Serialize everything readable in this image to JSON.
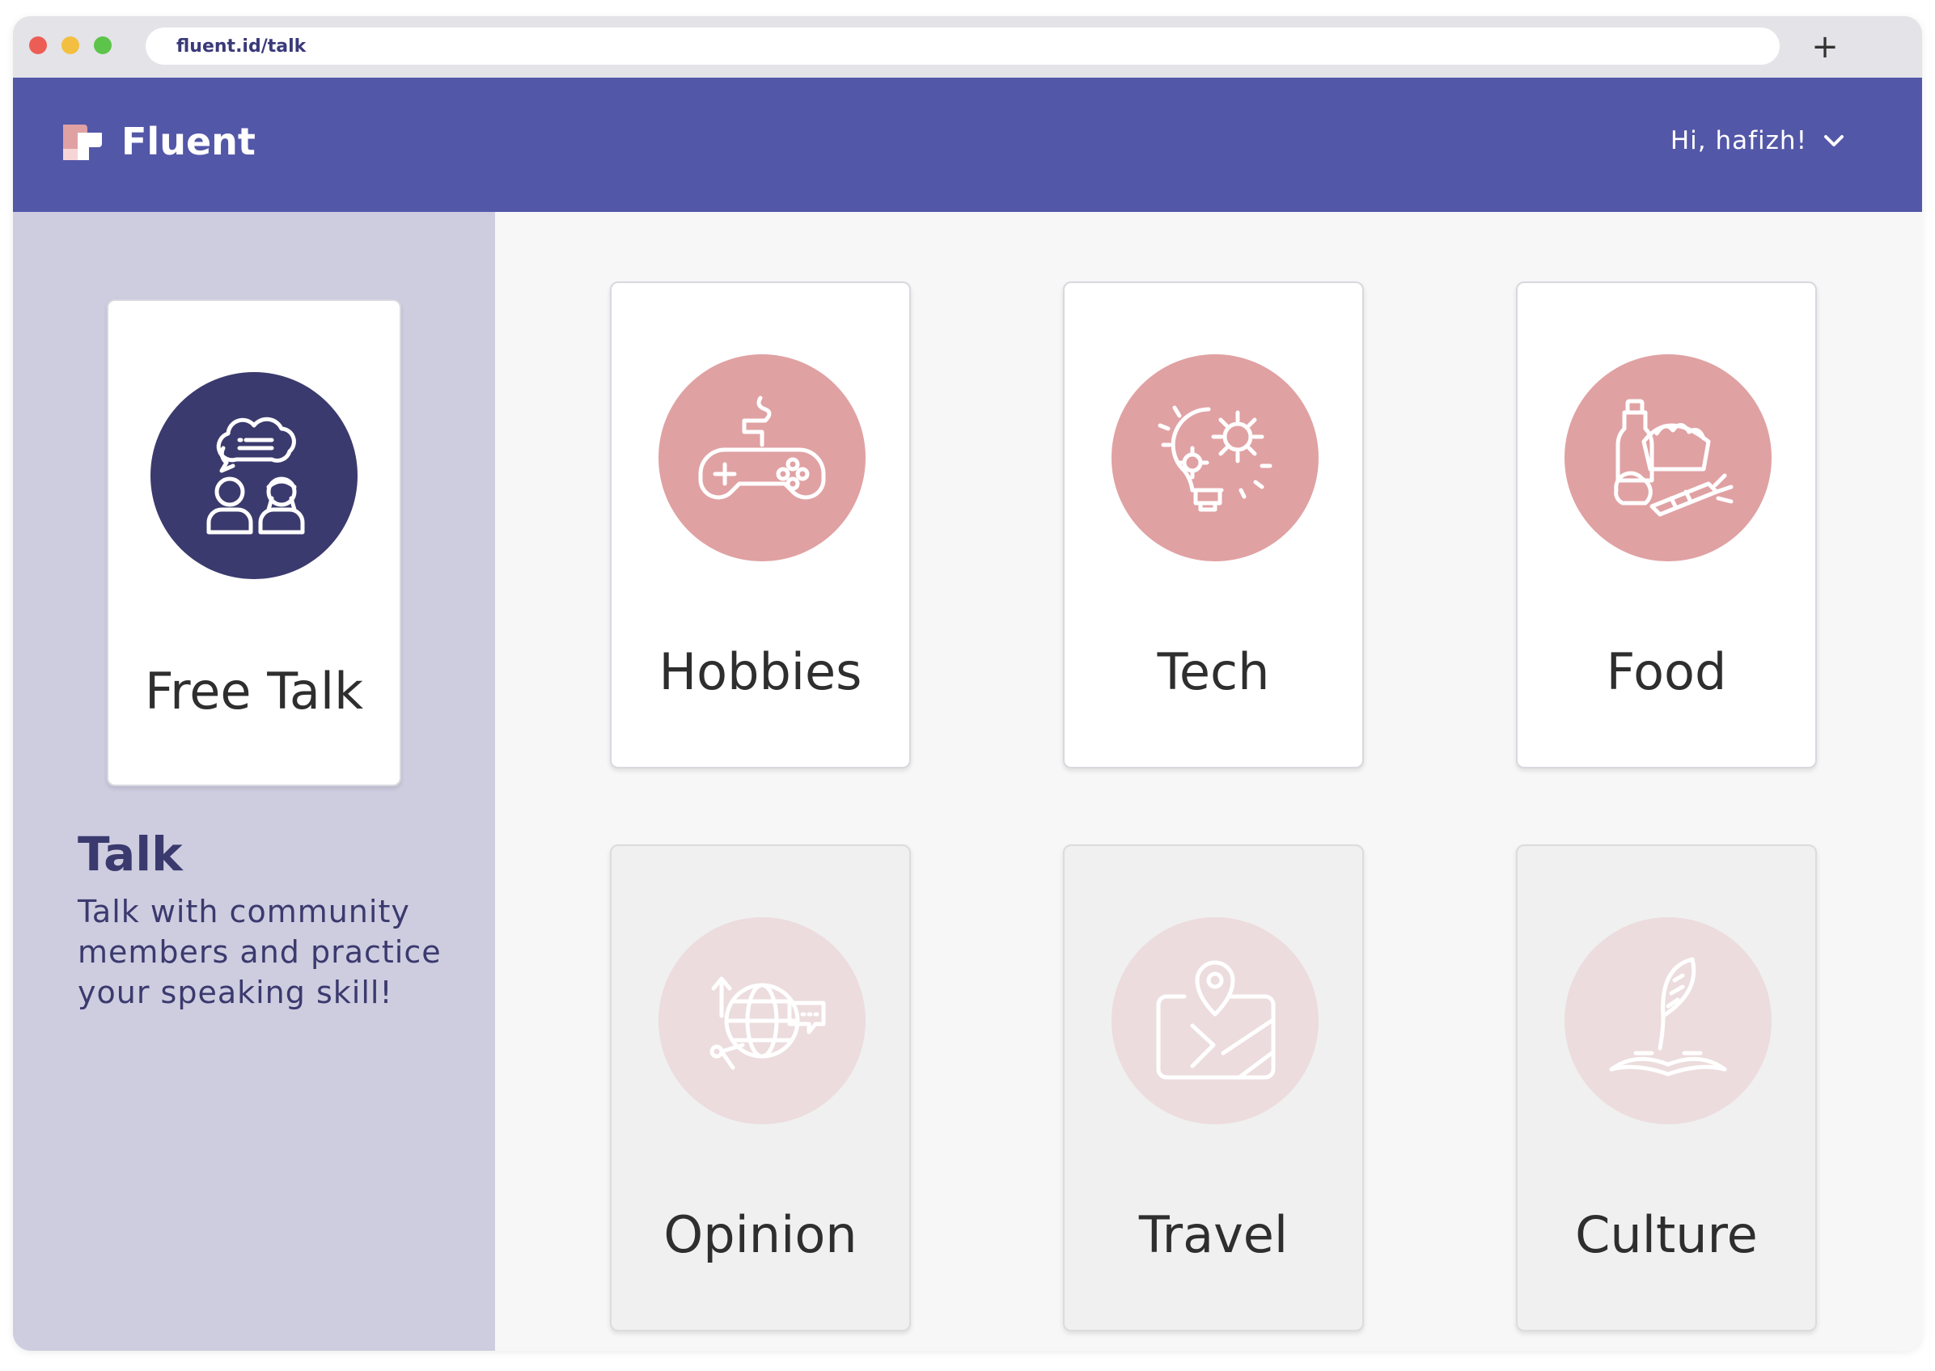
{
  "browser": {
    "url": "fluent.id/talk",
    "new_tab_label": "+"
  },
  "header": {
    "brand": "Fluent",
    "greeting": "Hi, hafizh!",
    "colors": {
      "bar": "#5357a8",
      "logo_pink": "#e0a1a3"
    }
  },
  "sidebar": {
    "featured_card": {
      "label": "Free Talk",
      "icon": "people-conversation-icon"
    },
    "title": "Talk",
    "description": "Talk with community members and practice your speaking skill!"
  },
  "topics": [
    {
      "label": "Hobbies",
      "icon": "gamepad-icon",
      "enabled": true
    },
    {
      "label": "Tech",
      "icon": "lightbulb-gears-icon",
      "enabled": true
    },
    {
      "label": "Food",
      "icon": "groceries-icon",
      "enabled": true
    },
    {
      "label": "Opinion",
      "icon": "globe-chat-icon",
      "enabled": false
    },
    {
      "label": "Travel",
      "icon": "map-pin-icon",
      "enabled": false
    },
    {
      "label": "Culture",
      "icon": "quill-book-icon",
      "enabled": false
    }
  ]
}
